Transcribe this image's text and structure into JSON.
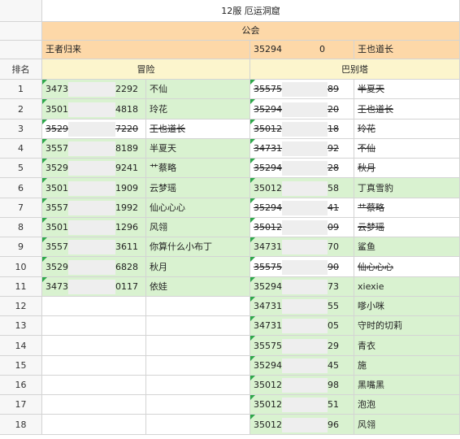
{
  "sheet": {
    "title": "12服 厄运洞窟",
    "guild_label": "公会",
    "guild_left": "王者归来",
    "guild_right_id_start": "35294",
    "guild_right_id_end": "0",
    "guild_right_name": "王也道长",
    "rank_header": "排名",
    "adventure_header": "冒险",
    "babel_header": "巴别塔"
  },
  "rows": [
    {
      "rank": "1",
      "a_id_start": "3473",
      "a_id_end": "2292",
      "a_name": "不仙",
      "a_bg": "green",
      "b_id_start": "35575",
      "b_id_end": "89",
      "b_name": "半夏天",
      "b_bg": "white",
      "b_strike": true
    },
    {
      "rank": "2",
      "a_id_start": "3501",
      "a_id_end": "4818",
      "a_name": "玲花",
      "a_bg": "green",
      "b_id_start": "35294",
      "b_id_end": "20",
      "b_name": "王也道长",
      "b_bg": "white",
      "b_strike": true
    },
    {
      "rank": "3",
      "a_id_start": "3529",
      "a_id_end": "7220",
      "a_name": "王也道长",
      "a_bg": "white",
      "a_strike": true,
      "b_id_start": "35012",
      "b_id_end": "18",
      "b_name": "玲花",
      "b_bg": "white",
      "b_strike": true
    },
    {
      "rank": "4",
      "a_id_start": "3557",
      "a_id_end": "8189",
      "a_name": "半夏天",
      "a_bg": "green",
      "b_id_start": "34731",
      "b_id_end": "92",
      "b_name": "不仙",
      "b_bg": "white",
      "b_strike": true
    },
    {
      "rank": "5",
      "a_id_start": "3529",
      "a_id_end": "9241",
      "a_name": "艹蔡略",
      "a_bg": "green",
      "b_id_start": "35294",
      "b_id_end": "28",
      "b_name": "秋月",
      "b_bg": "white",
      "b_strike": true
    },
    {
      "rank": "6",
      "a_id_start": "3501",
      "a_id_end": "1909",
      "a_name": "云梦瑶",
      "a_bg": "green",
      "b_id_start": "35012",
      "b_id_end": "58",
      "b_name": "丁真雪豹",
      "b_bg": "green",
      "b_strike": false
    },
    {
      "rank": "7",
      "a_id_start": "3557",
      "a_id_end": "1992",
      "a_name": "仙心心心",
      "a_bg": "green",
      "b_id_start": "35294",
      "b_id_end": "41",
      "b_name": "艹蔡略",
      "b_bg": "white",
      "b_strike": true
    },
    {
      "rank": "8",
      "a_id_start": "3501",
      "a_id_end": "1296",
      "a_name": "风翎",
      "a_bg": "green",
      "b_id_start": "35012",
      "b_id_end": "09",
      "b_name": "云梦瑶",
      "b_bg": "white",
      "b_strike": true
    },
    {
      "rank": "9",
      "a_id_start": "3557",
      "a_id_end": "3611",
      "a_name": "你算什么小布丁",
      "a_bg": "green",
      "b_id_start": "34731",
      "b_id_end": "70",
      "b_name": "鲨鱼",
      "b_bg": "green",
      "b_strike": false
    },
    {
      "rank": "10",
      "a_id_start": "3529",
      "a_id_end": "6828",
      "a_name": "秋月",
      "a_bg": "green",
      "b_id_start": "35575",
      "b_id_end": "90",
      "b_name": "仙心心心",
      "b_bg": "white",
      "b_strike": true
    },
    {
      "rank": "11",
      "a_id_start": "3473",
      "a_id_end": "0117",
      "a_name": "依娃",
      "a_bg": "green",
      "b_id_start": "35294",
      "b_id_end": "73",
      "b_name": "xiexie",
      "b_bg": "green",
      "b_strike": false
    },
    {
      "rank": "12",
      "a_id_start": "",
      "a_id_end": "",
      "a_name": "",
      "a_bg": "white",
      "b_id_start": "34731",
      "b_id_end": "55",
      "b_name": "嗲小咪",
      "b_bg": "green",
      "b_strike": false
    },
    {
      "rank": "13",
      "a_id_start": "",
      "a_id_end": "",
      "a_name": "",
      "a_bg": "white",
      "b_id_start": "34731",
      "b_id_end": "05",
      "b_name": "守时的切莉",
      "b_bg": "green",
      "b_strike": false
    },
    {
      "rank": "14",
      "a_id_start": "",
      "a_id_end": "",
      "a_name": "",
      "a_bg": "white",
      "b_id_start": "35575",
      "b_id_end": "29",
      "b_name": "青衣",
      "b_bg": "green",
      "b_strike": false
    },
    {
      "rank": "15",
      "a_id_start": "",
      "a_id_end": "",
      "a_name": "",
      "a_bg": "white",
      "b_id_start": "35294",
      "b_id_end": "45",
      "b_name": "施",
      "b_bg": "green",
      "b_strike": false
    },
    {
      "rank": "16",
      "a_id_start": "",
      "a_id_end": "",
      "a_name": "",
      "a_bg": "white",
      "b_id_start": "35012",
      "b_id_end": "98",
      "b_name": "黑嘴黑",
      "b_bg": "green",
      "b_strike": false
    },
    {
      "rank": "17",
      "a_id_start": "",
      "a_id_end": "",
      "a_name": "",
      "a_bg": "white",
      "b_id_start": "35012",
      "b_id_end": "51",
      "b_name": "泡泡",
      "b_bg": "green",
      "b_strike": false
    },
    {
      "rank": "18",
      "a_id_start": "",
      "a_id_end": "",
      "a_name": "",
      "a_bg": "white",
      "b_id_start": "35012",
      "b_id_end": "96",
      "b_name": "风翎",
      "b_bg": "green",
      "b_strike": false
    }
  ],
  "colors": {
    "orange": "#fdd8a8",
    "yellow": "#fcf5cd",
    "green": "#d9f2d0",
    "marker": "#2ea84a"
  }
}
